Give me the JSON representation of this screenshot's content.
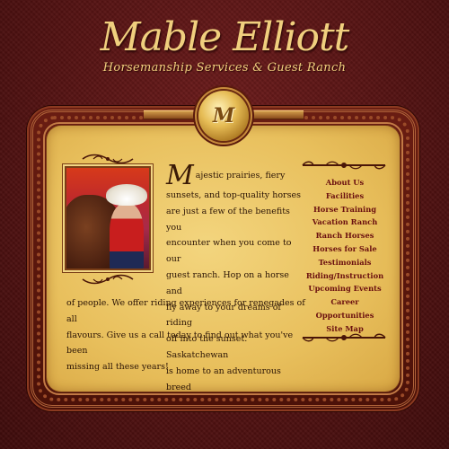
{
  "header": {
    "title": "Mable Elliott",
    "subtitle": "Horsemanship Services & Guest Ranch"
  },
  "medallion": {
    "monogram": "M"
  },
  "intro": {
    "dropcap": "M",
    "lines": [
      "ajestic prairies, fiery",
      "sunsets, and top-quality horses",
      "are just a few of the benefits you",
      "encounter when you come to our",
      "guest ranch. Hop on a horse and",
      "fly away to your dreams of riding",
      "off into the sunset. Saskatchewan",
      "is home to an adventurous breed"
    ],
    "full_lines": [
      "of  people. We offer riding experiences for renegades of all",
      "flavours. Give us a call today to find out what you've been",
      "missing all these years!"
    ]
  },
  "nav": {
    "items": [
      "About Us",
      "Facilities",
      "Horse Training",
      "Vacation Ranch",
      "Ranch Horses",
      "Horses for Sale",
      "Testimonials",
      "Riding/Instruction",
      "Upcoming Events",
      "Career Opportunities",
      "Site Map"
    ]
  },
  "colors": {
    "background": "#5a1414",
    "panel": "#e8bf5c",
    "title": "#f0cf7e",
    "nav_link": "#6a0f0f"
  },
  "icons": [
    "scroll-ornament-icon",
    "medallion-logo"
  ]
}
